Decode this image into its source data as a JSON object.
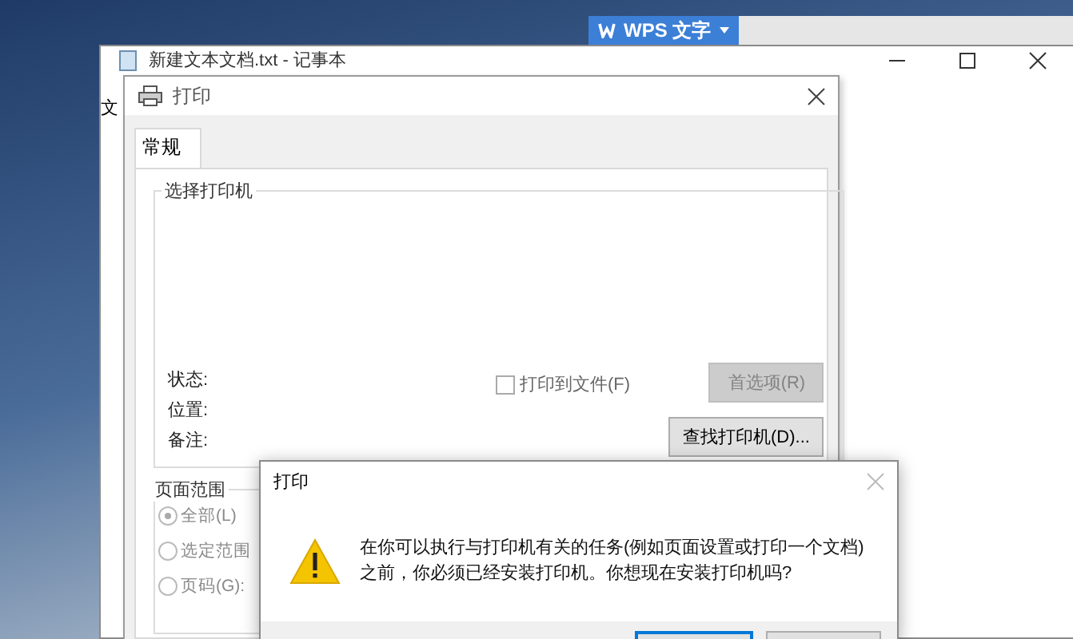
{
  "taskbar_app": {
    "label": "WPS 文字"
  },
  "notepad": {
    "title": "新建文本文档.txt - 记事本",
    "menu": [
      "文"
    ]
  },
  "print_dialog": {
    "title": "打印",
    "tabs": [
      {
        "label": "常规",
        "selected": true
      }
    ],
    "printer_group": {
      "title": "选择打印机",
      "fields": [
        "状态:",
        "位置:",
        "备注:"
      ],
      "print_to_file": {
        "label": "打印到文件(F)",
        "checked": false
      },
      "buttons": [
        {
          "label": "首选项(R)",
          "disabled": true
        },
        {
          "label": "查找打印机(D)...",
          "disabled": false
        }
      ]
    },
    "page_range": {
      "title": "页面范围",
      "options": [
        {
          "label": "全部(L)",
          "selected": true
        },
        {
          "label": "选定范围",
          "selected": false
        },
        {
          "label": "页码(G):",
          "selected": false
        }
      ]
    }
  },
  "message_box": {
    "title": "打印",
    "message": "在你可以执行与打印机有关的任务(例如页面设置或打印一个文档)之前，你必须已经安装打印机。你想现在安装打印机吗?"
  }
}
